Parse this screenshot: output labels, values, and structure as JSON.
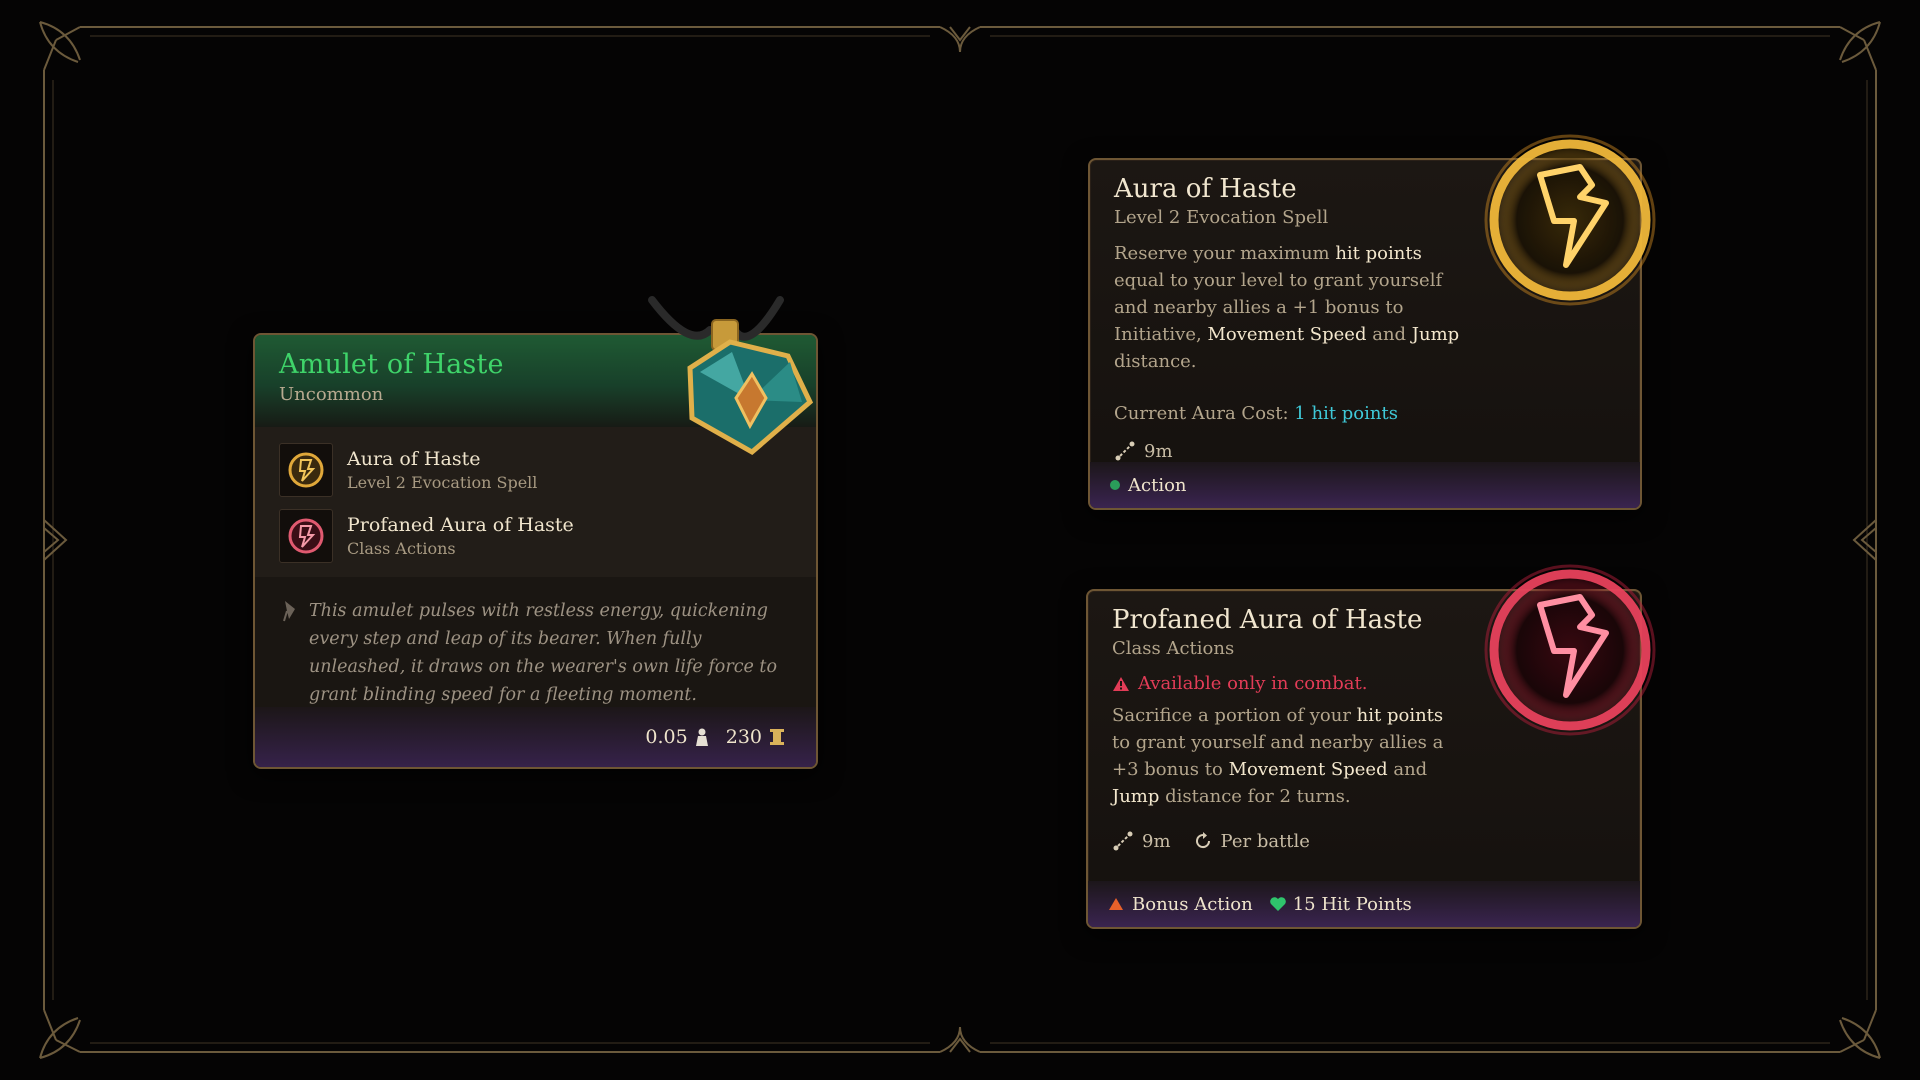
{
  "colors": {
    "gold": "#c8a05a",
    "green": "#3fd46a",
    "cyan": "#3fc9d8",
    "red": "#e23c57",
    "purple": "#3a2450"
  },
  "amulet": {
    "name": "Amulet of Haste",
    "rarity": "Uncommon",
    "icon": "amulet-gem-icon",
    "spells": [
      {
        "name": "Aura of Haste",
        "sub": "Level 2 Evocation Spell",
        "icon": "aura-haste-icon"
      },
      {
        "name": "Profaned Aura of Haste",
        "sub": "Class Actions",
        "icon": "profaned-aura-icon"
      }
    ],
    "lore": "This amulet pulses with restless energy, quickening every step and leap of its bearer. When fully unleashed, it draws on the wearer's own life force to grant blinding speed for a fleeting moment.",
    "weight": "0.05",
    "value": "230"
  },
  "aura": {
    "title": "Aura of Haste",
    "sub": "Level 2 Evocation Spell",
    "desc": {
      "p1": "Reserve your maximum ",
      "h1": "hit points",
      "p2": " equal to your level to grant yourself and nearby allies a +1 bonus to Initiative, ",
      "h2": "Movement Speed",
      "p3": " and ",
      "h3": "Jump",
      "p4": " distance."
    },
    "cost_label": "Current Aura Cost: ",
    "cost_value": "1 hit points",
    "range": "9m",
    "action": "Action"
  },
  "profane": {
    "title": "Profaned Aura of Haste",
    "sub": "Class Actions",
    "warning": "Available only in combat.",
    "desc": {
      "p1": "Sacrifice a portion of your ",
      "h1": "hit points",
      "p2": " to grant yourself and nearby allies a +3 bonus to ",
      "h2": "Movement Speed",
      "p3": " and ",
      "h3": "Jump",
      "p4": " distance for 2 turns."
    },
    "range": "9m",
    "recharge": "Per battle",
    "action": "Bonus Action",
    "hp_cost": "15 Hit Points"
  }
}
